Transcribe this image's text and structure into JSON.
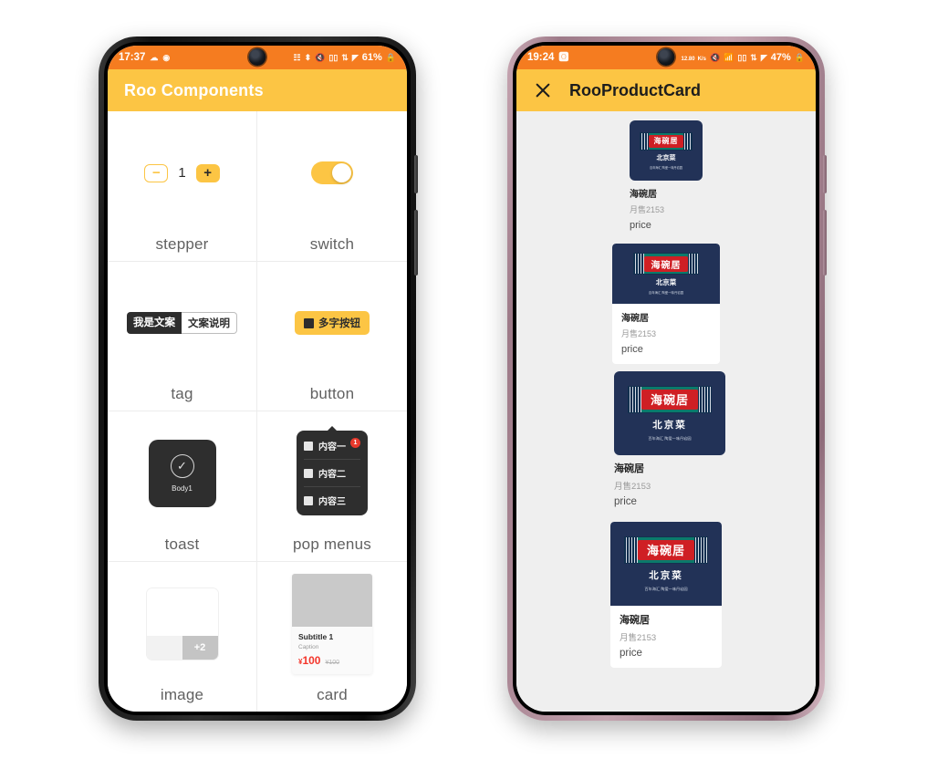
{
  "left_phone": {
    "status": {
      "time": "17:37",
      "left_icons": [
        "weather-icon",
        "app-badge-icon"
      ],
      "right_icons": [
        "network-share-icon",
        "bluetooth-icon",
        "mute-icon",
        "hd-icon",
        "data-icon",
        "signal-icon"
      ],
      "battery": "61%",
      "battery_icon": "battery-lock-icon"
    },
    "appbar": {
      "title": "Roo Components"
    },
    "cells": [
      {
        "label": "stepper",
        "stepper": {
          "minus": "−",
          "value": "1",
          "plus": "+"
        }
      },
      {
        "label": "switch",
        "switch_on": true
      },
      {
        "label": "tag",
        "tags": [
          "我是文案",
          "文案说明"
        ]
      },
      {
        "label": "button",
        "button_text": "多字按钮"
      },
      {
        "label": "toast",
        "toast": {
          "icon": "check-circle-icon",
          "text": "Body1"
        }
      },
      {
        "label": "pop menus",
        "menu_items": [
          "内容一",
          "内容二",
          "内容三"
        ],
        "badge": "1"
      },
      {
        "label": "image",
        "overflow_count": "+2"
      },
      {
        "label": "card",
        "card": {
          "subtitle": "Subtitle 1",
          "caption": "Caption",
          "yen": "¥",
          "price": "100",
          "old_price": "¥100"
        }
      }
    ]
  },
  "right_phone": {
    "status": {
      "time": "19:24",
      "left_icons": [
        "opera-icon"
      ],
      "speed_value": "12.80",
      "speed_unit": "K/s",
      "right_icons": [
        "mute-icon",
        "wifi-icon",
        "hd-icon",
        "data-icon",
        "signal-icon"
      ],
      "battery": "47%",
      "battery_icon": "battery-lock-icon"
    },
    "appbar": {
      "close_icon": "close-icon",
      "title": "RooProductCard"
    },
    "logo": {
      "brand": "海碗居",
      "cuisine": "北京菜",
      "tagline": "百年海汇  陶爱一味丹宕园"
    },
    "products": [
      {
        "name": "海碗居",
        "sales": "月售2153",
        "price": "price",
        "boxed": false,
        "size": "small"
      },
      {
        "name": "海碗居",
        "sales": "月售2153",
        "price": "price",
        "boxed": true,
        "size": "small"
      },
      {
        "name": "海碗居",
        "sales": "月售2153",
        "price": "price",
        "boxed": false,
        "size": "large"
      },
      {
        "name": "海碗居",
        "sales": "月售2153",
        "price": "price",
        "boxed": true,
        "size": "large"
      }
    ]
  },
  "colors": {
    "status_bar": "#f57c20",
    "app_bar": "#fcc544",
    "accent": "#fcc544",
    "list_bg": "#efefef",
    "logo_navy": "#223257",
    "logo_red": "#cf1f24",
    "logo_green": "#0b7a6b",
    "price_red": "#f4362b",
    "badge_red": "#e8392c"
  }
}
